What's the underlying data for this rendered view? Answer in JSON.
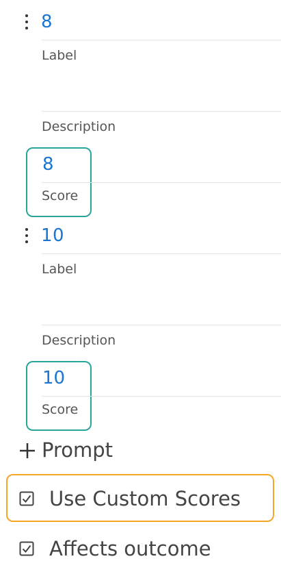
{
  "prompts": [
    {
      "value": "8",
      "label_placeholder": "Label",
      "description_placeholder": "Description",
      "score_value": "8",
      "score_label": "Score"
    },
    {
      "value": "10",
      "label_placeholder": "Label",
      "description_placeholder": "Description",
      "score_value": "10",
      "score_label": "Score"
    }
  ],
  "add_prompt": {
    "icon": "plus-icon",
    "label": "Prompt"
  },
  "options": {
    "use_custom_scores": {
      "label": "Use Custom Scores",
      "checked": true
    },
    "affects_outcome": {
      "label": "Affects outcome",
      "checked": true
    }
  },
  "colors": {
    "value_blue": "#1976d2",
    "highlight_teal": "#26a69a",
    "highlight_orange": "#f5a623"
  }
}
